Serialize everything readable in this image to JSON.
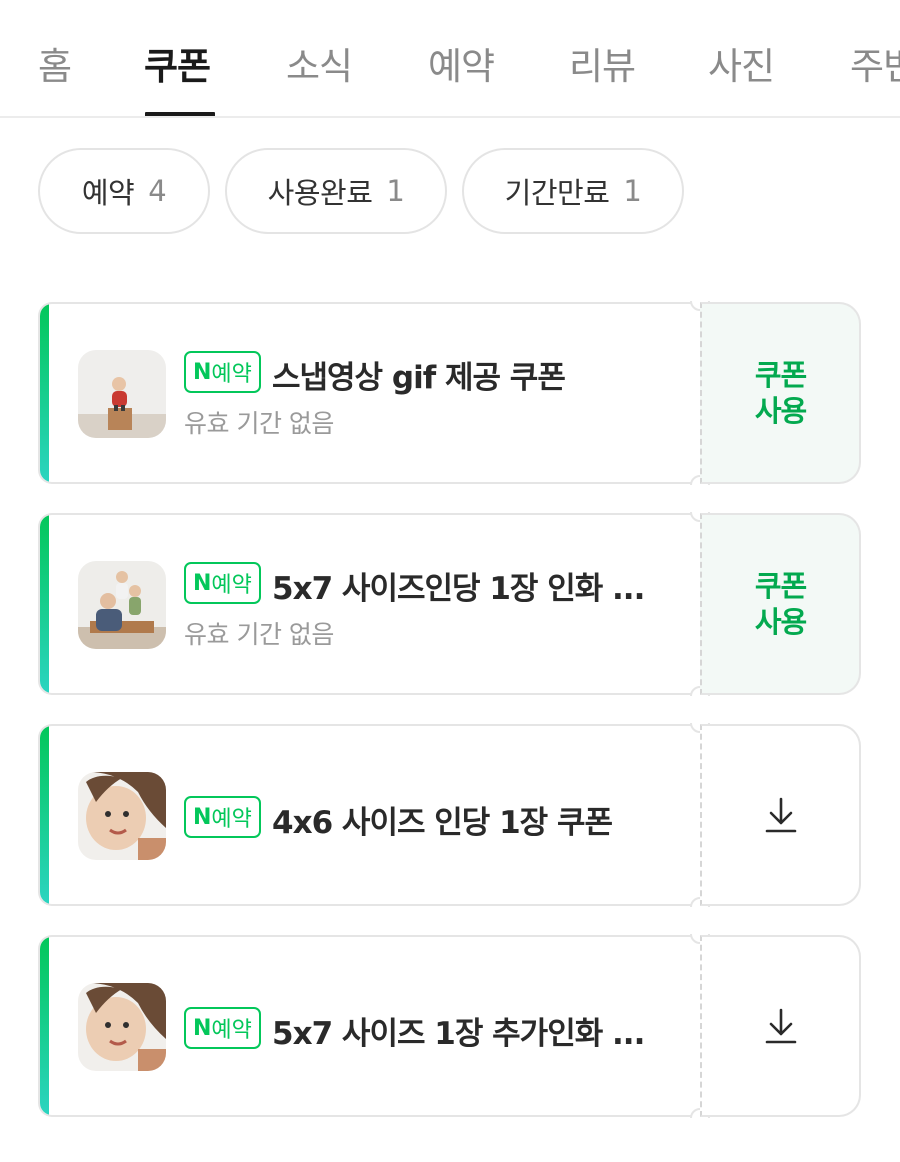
{
  "tabs": [
    {
      "label": "홈",
      "active": false
    },
    {
      "label": "쿠폰",
      "active": true
    },
    {
      "label": "소식",
      "active": false
    },
    {
      "label": "예약",
      "active": false
    },
    {
      "label": "리뷰",
      "active": false
    },
    {
      "label": "사진",
      "active": false
    },
    {
      "label": "주변",
      "active": false
    }
  ],
  "filters": [
    {
      "label": "예약",
      "count": "4"
    },
    {
      "label": "사용완료",
      "count": "1"
    },
    {
      "label": "기간만료",
      "count": "1"
    }
  ],
  "coupons": [
    {
      "badge_n": "N",
      "badge_label": "예약",
      "title": "스냅영상 gif 제공 쿠폰",
      "validity": "유효 기간 없음",
      "action": "쿠폰\n사용",
      "action_type": "use",
      "thumb": "studio-child-photo"
    },
    {
      "badge_n": "N",
      "badge_label": "예약",
      "title": "5x7 사이즈인당 1장 인화 ...",
      "validity": "유효 기간 없음",
      "action": "쿠폰\n사용",
      "action_type": "use",
      "thumb": "family-photo"
    },
    {
      "badge_n": "N",
      "badge_label": "예약",
      "title": "4x6 사이즈 인당 1장 쿠폰",
      "validity": "",
      "action": "download-icon",
      "action_type": "download",
      "thumb": "child-portrait"
    },
    {
      "badge_n": "N",
      "badge_label": "예약",
      "title": "5x7 사이즈 1장 추가인화 ...",
      "validity": "",
      "action": "download-icon",
      "action_type": "download",
      "thumb": "child-portrait"
    }
  ],
  "colors": {
    "accent_green": "#03c75a",
    "use_text": "#03a94f",
    "use_bg": "#f3f9f6"
  }
}
